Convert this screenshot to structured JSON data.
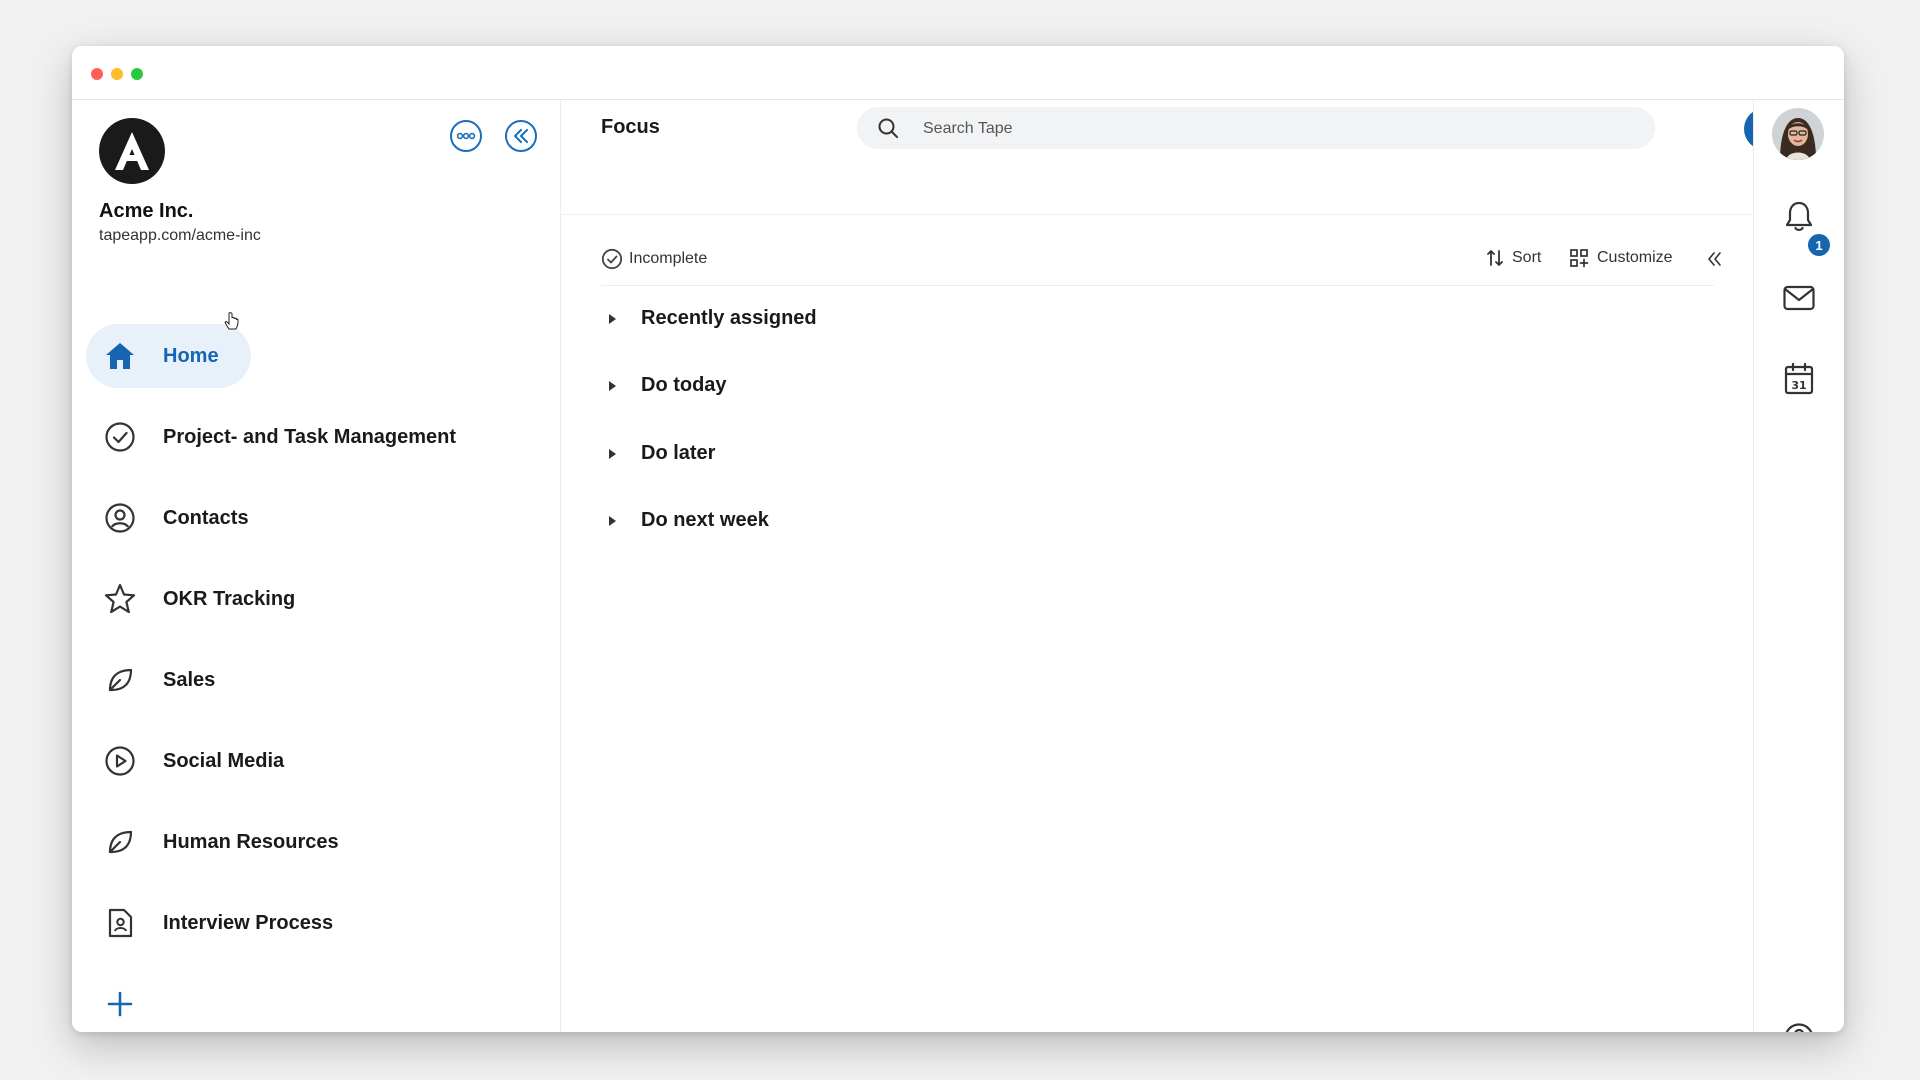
{
  "org": {
    "name": "Acme Inc.",
    "url": "tapeapp.com/acme-inc",
    "logo_letter": "A"
  },
  "sidebar": {
    "items": [
      {
        "label": "Home",
        "icon": "home-icon",
        "active": true
      },
      {
        "label": "Project- and Task Management",
        "icon": "check-circle-icon"
      },
      {
        "label": "Contacts",
        "icon": "user-circle-icon"
      },
      {
        "label": "OKR Tracking",
        "icon": "star-icon"
      },
      {
        "label": "Sales",
        "icon": "leaf-icon"
      },
      {
        "label": "Social Media",
        "icon": "play-circle-icon"
      },
      {
        "label": "Human Resources",
        "icon": "leaf-icon"
      },
      {
        "label": "Interview Process",
        "icon": "document-user-icon"
      }
    ]
  },
  "header": {
    "title": "Focus",
    "search_placeholder": "Search Tape"
  },
  "filters": {
    "status": "Incomplete",
    "sort_label": "Sort",
    "customize_label": "Customize"
  },
  "groups": [
    {
      "label": "Recently assigned"
    },
    {
      "label": "Do today"
    },
    {
      "label": "Do later"
    },
    {
      "label": "Do next week"
    }
  ],
  "rail": {
    "notification_count": "1",
    "calendar_day": "31"
  },
  "colors": {
    "accent": "#1565b0",
    "active_bg": "#e8f1fa"
  }
}
